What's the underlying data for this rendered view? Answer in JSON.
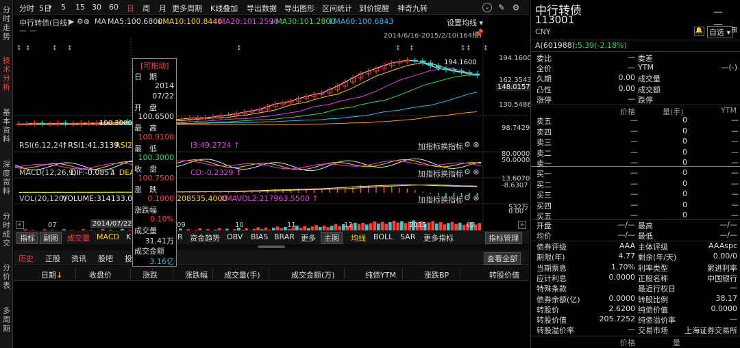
{
  "vtabs": [
    "分时走势",
    "技术分析",
    "基本资料",
    "深度资料",
    "分时成交",
    "分价表",
    "多周期"
  ],
  "toolbar": {
    "items": [
      "分时",
      "5日",
      "5",
      "15",
      "30",
      "60",
      "日",
      "周",
      "月",
      "更多周期",
      "K线叠加",
      "导出数据",
      "导出图形",
      "区间统计",
      "到价提醒",
      "神奇九转"
    ],
    "active": "日"
  },
  "chart": {
    "title": "中行转债(日线)",
    "ma_label": "MA",
    "ma": [
      {
        "label": "MA5:100.6800",
        "color": "#e8e8e8"
      },
      {
        "label": "MA10:100.8440",
        "color": "#ffd400"
      },
      {
        "label": "MA20:101.2590",
        "color": "#e040e0"
      },
      {
        "label": "MA30:101.2800",
        "color": "#3cd84a"
      },
      {
        "label": "MA60:100.6843",
        "color": "#30b8e8"
      }
    ],
    "settings_label": "设置均线",
    "range_label": "2014/6/16-2015/2/10(164根)",
    "price_axis": [
      "194.1600",
      "162.3543",
      "148.0157",
      "130.5486",
      "98.7429"
    ],
    "peak_label": "194.1600",
    "low_label": "100.3000",
    "rsi": {
      "name": "RSI(6,12,24)",
      "v1": "RSI1:41.3139",
      "v2": "RSI2:",
      "v3": "I3:49.2724",
      "axis": [
        "80.0000",
        "50.0000"
      ]
    },
    "macd": {
      "name": "MACD(12,26,9)",
      "dif": "DIF:-0.0857",
      "dea": "DEA",
      "macd": "CD:-0.2329",
      "axis": [
        "13.6070",
        "-8.6307"
      ]
    },
    "vol": {
      "name": "VOL(20,120)",
      "volume": "VOLUME:314133.0000",
      "mavol1": "208535.4000",
      "mavol2": "MAVOL2:217963.5500",
      "axis": [
        "532万",
        "0.00"
      ]
    },
    "panel_ctrl": {
      "add": "加指标",
      "switch": "换指标"
    },
    "time_axis": [
      "07",
      "2014/07/22",
      "09",
      "10",
      "11",
      "12",
      "2015",
      "02"
    ],
    "candles": [
      0.05,
      0.05,
      0.06,
      0.05,
      0.05,
      0.06,
      0.05,
      0.05,
      0.06,
      0.06,
      0.06,
      0.07,
      0.07,
      0.08,
      0.07,
      0.08,
      0.08,
      0.09,
      0.1,
      0.1,
      0.11,
      0.12,
      0.13,
      0.14,
      0.14,
      0.15,
      0.17,
      0.18,
      0.2,
      0.22,
      0.24,
      0.26,
      0.3,
      0.34,
      0.36,
      0.38,
      0.42,
      0.45,
      0.48,
      0.5,
      0.55,
      0.6,
      0.66,
      0.72,
      0.78,
      0.82,
      0.86,
      0.9,
      0.94,
      0.96,
      0.98,
      0.97,
      0.94,
      0.9,
      0.86,
      0.84,
      0.82,
      0.8,
      0.78,
      0.76
    ]
  },
  "indicator_tabs": [
    "指标",
    "副图",
    "成交量",
    "MACD",
    "K",
    "R",
    "资金趋势",
    "OBV",
    "BIAS",
    "BRAR",
    "更多",
    "主图",
    "均线",
    "BOLL",
    "SAR",
    "更多指标",
    "指标管理"
  ],
  "history": {
    "tabs": [
      "历史",
      "正股",
      "资讯",
      "股吧",
      "投"
    ],
    "view_all": "查看全部",
    "columns": [
      "日期",
      "收盘价",
      "涨跌",
      "涨跌幅",
      "成交量(手)",
      "成交金额(万)",
      "纯债YTM",
      "涨跌BP",
      "转股价值"
    ]
  },
  "tooltip": {
    "drag": "[可拖动]",
    "rows": [
      {
        "label": "日　期",
        "value": "2014",
        "value2": "07/22",
        "color": "#ddd"
      },
      {
        "label": "开　盘",
        "value": "100.6500",
        "color": "#ddd"
      },
      {
        "label": "最　高",
        "value": "100.9100",
        "color": "#ff3d3d"
      },
      {
        "label": "最　低",
        "value": "100.3000",
        "color": "#24d35a"
      },
      {
        "label": "收　盘",
        "value": "100.7500",
        "color": "#ff3d3d"
      },
      {
        "label": "涨　跌",
        "value": "0.1000",
        "color": "#ff3d3d"
      },
      {
        "label": "涨跌幅",
        "value": "0.10%",
        "color": "#ff3d3d"
      },
      {
        "label": "成交量",
        "value": "31.41万",
        "color": "#ddd"
      },
      {
        "label": "成交金额",
        "value": "3.16亿",
        "color": "#30b8e8"
      }
    ]
  },
  "right": {
    "name": "中行转债",
    "code": "113001",
    "currency": "CNY",
    "watch": "自选",
    "stock": "A(601988):",
    "stock_price": "5.39(-2.18%)",
    "rows1": [
      [
        "委比",
        "—",
        "委差",
        ""
      ],
      [
        "全价",
        "—",
        "YTM",
        "—(-)"
      ],
      [
        "久期",
        "0.00",
        "成交量",
        ""
      ],
      [
        "凸性",
        "0.00",
        "成交额",
        ""
      ],
      [
        "涨停",
        "—",
        "跌停",
        ""
      ]
    ],
    "book_head": [
      "价格",
      "量(手)",
      "YTM"
    ],
    "asks": [
      [
        "卖五",
        "—",
        "0",
        "—"
      ],
      [
        "卖四",
        "—",
        "0",
        "—"
      ],
      [
        "卖三",
        "—",
        "0",
        "—"
      ],
      [
        "卖二",
        "—",
        "0",
        "—"
      ],
      [
        "卖一",
        "—",
        "0",
        "—"
      ]
    ],
    "bids": [
      [
        "买一",
        "—",
        "0",
        "—"
      ],
      [
        "买二",
        "—",
        "0",
        "—"
      ],
      [
        "买三",
        "—",
        "0",
        "—"
      ],
      [
        "买四",
        "—",
        "0",
        "—"
      ],
      [
        "买五",
        "—",
        "0",
        "—"
      ]
    ],
    "rows2": [
      [
        "开盘",
        "—/—",
        "最高",
        "—/—"
      ],
      [
        "均价",
        "—/—",
        "最低",
        "—/—"
      ]
    ],
    "rows3": [
      [
        "债券评级",
        "AAA",
        "主体评级",
        "AAAspc"
      ],
      [
        "期限(年)",
        "4.77",
        "剩余(年/天)",
        "0.00/0"
      ],
      [
        "当期票息",
        "1.70%",
        "利率类型",
        "累进利率"
      ],
      [
        "应计利息",
        "0.0000",
        "正股名称",
        "中国银行"
      ],
      [
        "特殊条款",
        "",
        "最近行权日",
        "—"
      ],
      [
        "债券余额(亿)",
        "0.0000",
        "转股比例",
        "38.17"
      ],
      [
        "转股价",
        "2.6200",
        "纯债价值",
        "0.0000"
      ],
      [
        "转股价值",
        "205.7252",
        "纯债溢价率",
        "—"
      ],
      [
        "转股溢价率",
        "—",
        "交易市场",
        "上海证券交易所"
      ]
    ],
    "foot": [
      "价格",
      "量"
    ]
  }
}
